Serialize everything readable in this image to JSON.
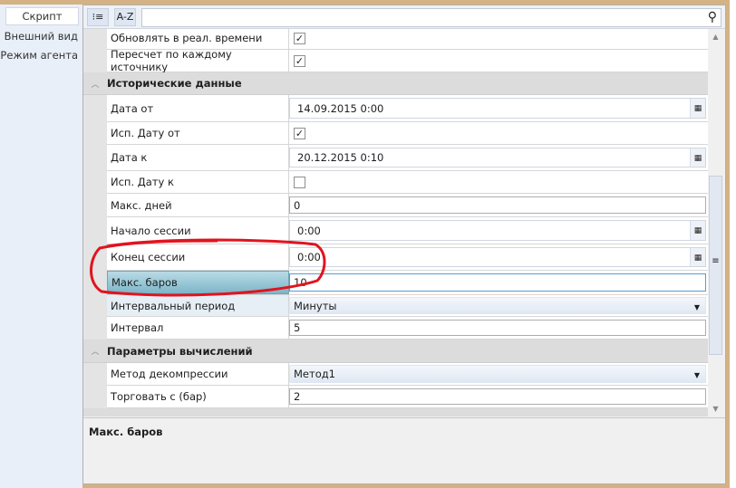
{
  "nav": {
    "items": [
      "Скрипт",
      "Внешний вид",
      "Режим агента"
    ],
    "selected": "Скрипт"
  },
  "toolbar": {
    "categorized": "categorized-icon",
    "az_label": "A-Z",
    "search_placeholder": "",
    "search_icon": "search-icon"
  },
  "rows": {
    "r_update": {
      "label": "Обновлять в реал. времени",
      "checked": true
    },
    "r_recalc": {
      "label": "Пересчет по каждому источнику",
      "checked": true
    },
    "sec_hist": "Исторические данные",
    "r_from": {
      "label": "Дата от",
      "value": "14.09.2015 0:00"
    },
    "r_usefrom": {
      "label": "Исп. Дату от",
      "checked": true
    },
    "r_to": {
      "label": "Дата к",
      "value": "20.12.2015 0:10"
    },
    "r_useto": {
      "label": "Исп. Дату к",
      "checked": false
    },
    "r_maxdays": {
      "label": "Макс. дней",
      "value": "0"
    },
    "r_sstart": {
      "label": "Начало сессии",
      "value": "0:00"
    },
    "r_send": {
      "label": "Конец сессии",
      "value": "0:00"
    },
    "r_maxbars": {
      "label": "Макс. баров",
      "value": "10"
    },
    "r_period": {
      "label": "Интервальный период",
      "value": "Минуты"
    },
    "r_interval": {
      "label": "Интервал",
      "value": "5"
    },
    "sec_calc": "Параметры вычислений",
    "r_method": {
      "label": "Метод декомпрессии",
      "value": "Метод1"
    },
    "r_trade": {
      "label": "Торговать с (бар)",
      "value": "2"
    }
  },
  "description": {
    "title": "Макс. баров"
  },
  "colors": {
    "highlight": "#7db5c8",
    "annotation": "#e0141e"
  }
}
